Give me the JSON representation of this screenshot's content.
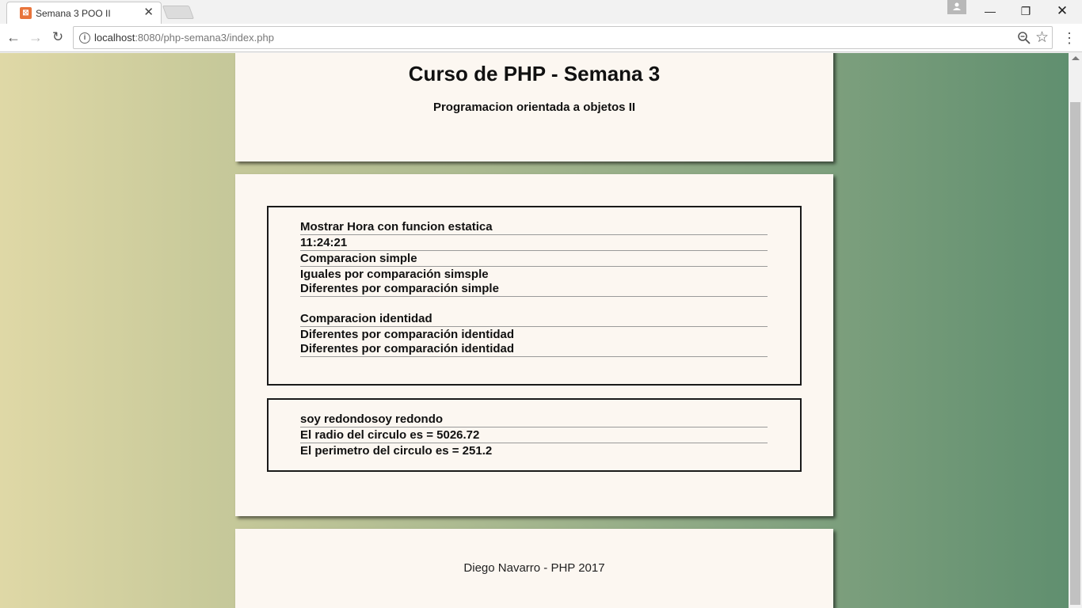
{
  "browser": {
    "tab_title": "Semana 3 POO II",
    "url_host": "localhost",
    "url_rest": ":8080/php-semana3/index.php"
  },
  "header": {
    "title": "Curso de PHP - Semana 3",
    "subtitle": "Programacion orientada a objetos II"
  },
  "box1": {
    "lines": [
      "Mostrar Hora con funcion estatica",
      "11:24:21",
      "Comparacion simple",
      "Iguales por comparación simsple",
      "Diferentes por comparación simple",
      "Comparacion identidad",
      "Diferentes por comparación identidad",
      "Diferentes por comparación identidad"
    ]
  },
  "box2": {
    "lines": [
      "soy redondosoy redondo",
      "El radio del circulo es = 5026.72",
      "El perimetro del circulo es = 251.2"
    ]
  },
  "footer": {
    "text": "Diego Navarro - PHP 2017"
  },
  "icons": {
    "favicon": "xampp-icon",
    "back": "back-arrow-icon",
    "forward": "forward-arrow-icon",
    "reload": "reload-icon",
    "info": "info-icon",
    "zoom": "zoom-icon",
    "bookmark": "star-icon",
    "menu": "menu-icon",
    "profile": "profile-icon"
  },
  "colors": {
    "panel_bg": "#fcf7f1",
    "gradient_left": "#dfd8a6",
    "gradient_right": "#608f6f"
  }
}
